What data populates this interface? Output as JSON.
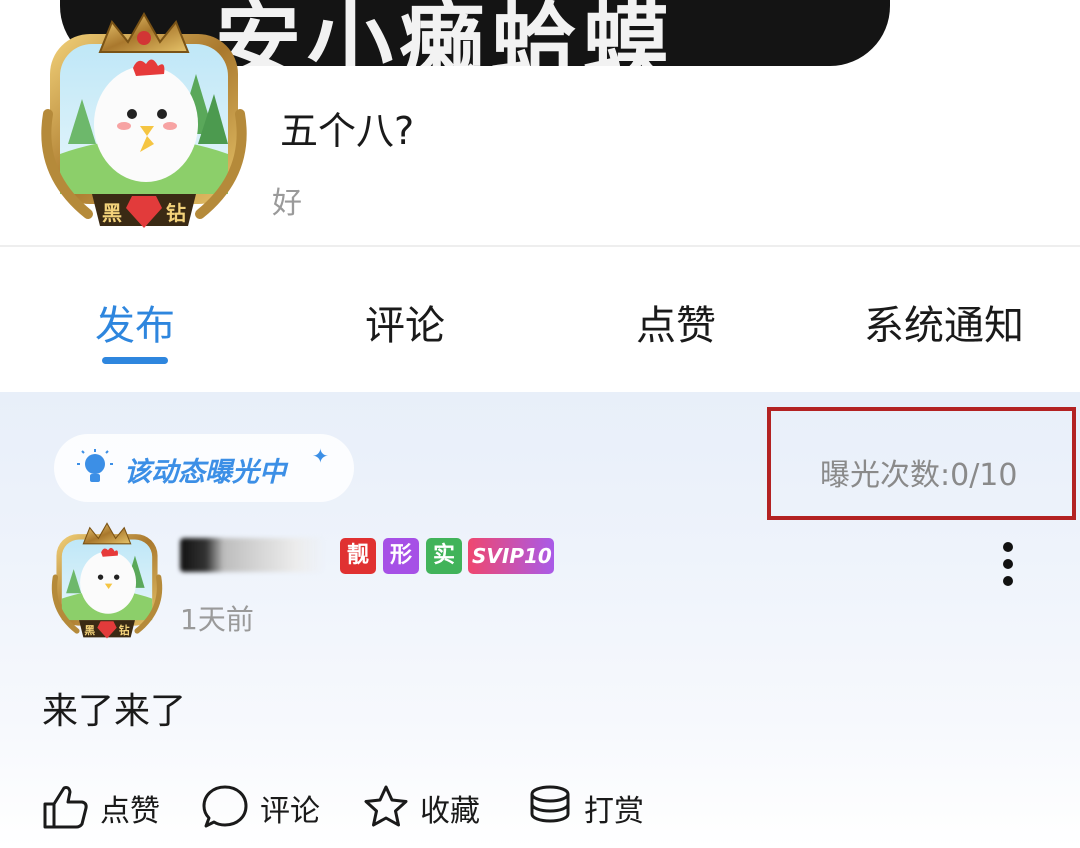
{
  "banner": {
    "text": "安小癞蛤蟆"
  },
  "profile": {
    "nickname": "五个八?",
    "bio": "好",
    "avatar_badge": "黑钻"
  },
  "tabs": [
    {
      "label": "发布",
      "active": true
    },
    {
      "label": "评论",
      "active": false
    },
    {
      "label": "点赞",
      "active": false
    },
    {
      "label": "系统通知",
      "active": false
    }
  ],
  "exposure": {
    "status_label": "该动态曝光中",
    "count_text": "曝光次数:0/10"
  },
  "post": {
    "badges": [
      "靓",
      "形",
      "实",
      "SVIP10"
    ],
    "time": "1天前",
    "content": "来了来了",
    "avatar_badge": "黑钻",
    "actions": [
      {
        "label": "点赞",
        "icon": "thumbs-up-icon"
      },
      {
        "label": "评论",
        "icon": "comment-icon"
      },
      {
        "label": "收藏",
        "icon": "star-icon"
      },
      {
        "label": "打赏",
        "icon": "coins-icon"
      }
    ]
  },
  "colors": {
    "accent": "#2e86de",
    "highlight_box": "#b32222"
  }
}
